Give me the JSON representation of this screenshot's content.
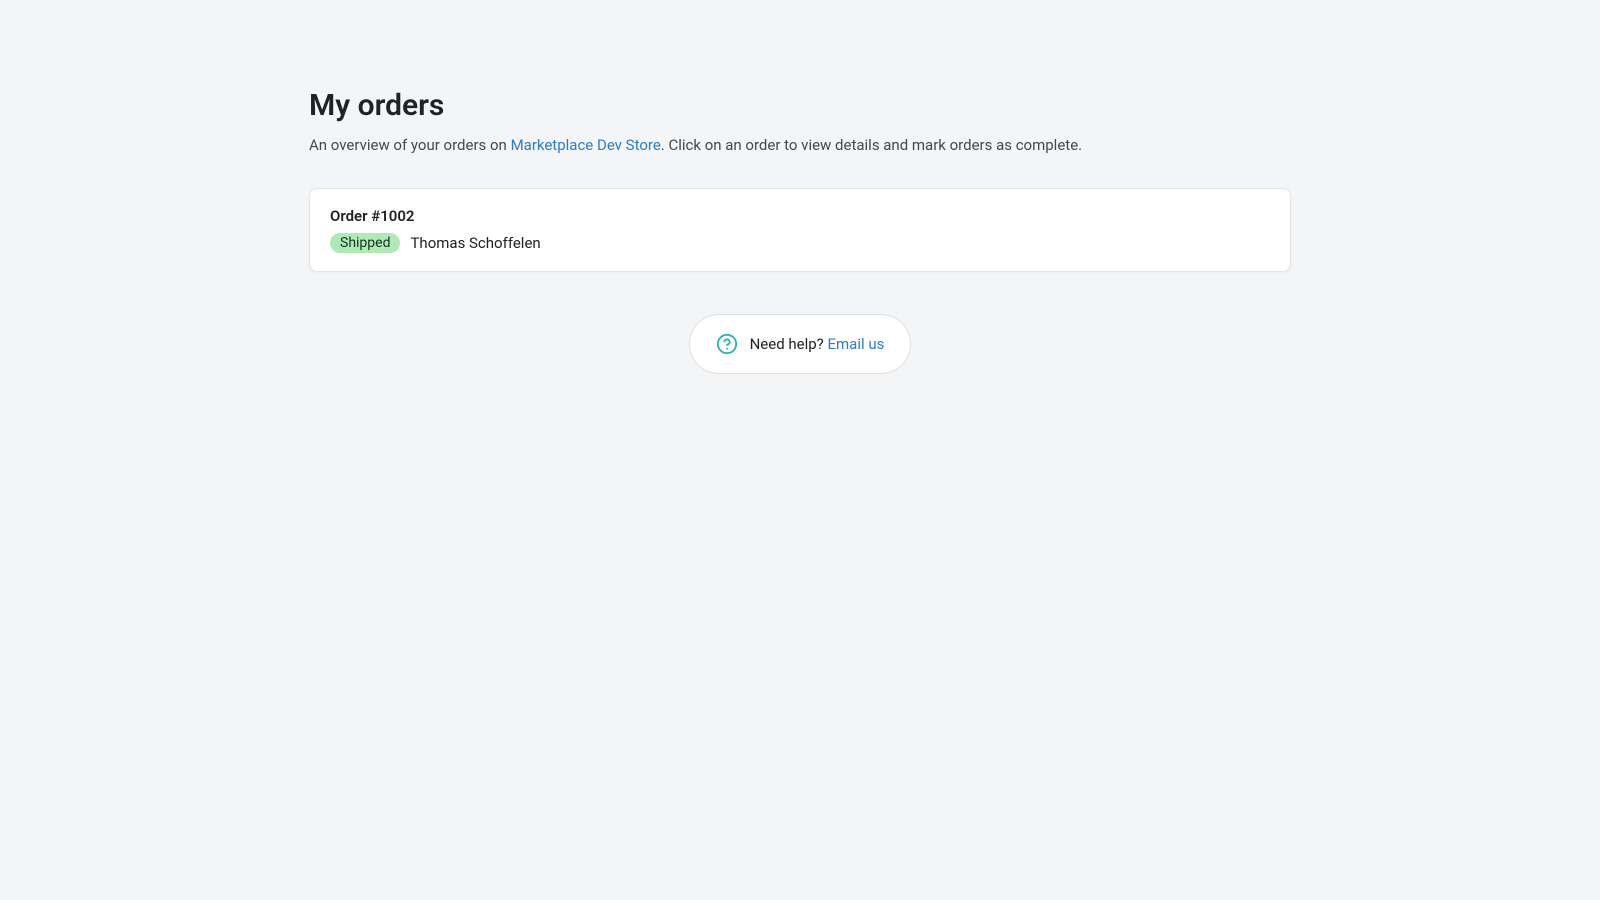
{
  "header": {
    "title": "My orders",
    "subtitle_prefix": "An overview of your orders on ",
    "store_link_text": "Marketplace Dev Store",
    "subtitle_suffix": ". Click on an order to view details and mark orders as complete."
  },
  "orders": [
    {
      "title": "Order #1002",
      "status": "Shipped",
      "customer": "Thomas Schoffelen"
    }
  ],
  "help": {
    "prefix": "Need help? ",
    "link_text": "Email us"
  }
}
